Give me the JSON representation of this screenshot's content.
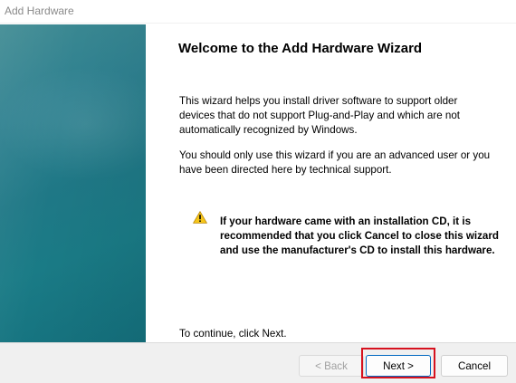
{
  "window": {
    "title": "Add Hardware"
  },
  "wizard": {
    "heading": "Welcome to the Add Hardware Wizard",
    "paragraph1": "This wizard helps you install driver software to support older devices that do not support Plug-and-Play and which are not automatically recognized by Windows.",
    "paragraph2": "You should only use this wizard if you are an advanced user or you have been directed here by technical support.",
    "warning_text": "If your hardware came with an installation CD, it is recommended that you click Cancel to close this wizard and use the manufacturer's CD to install this hardware.",
    "continue_text": "To continue, click Next."
  },
  "buttons": {
    "back_label": "< Back",
    "next_label": "Next >",
    "cancel_label": "Cancel"
  },
  "icons": {
    "warning": "warning-icon"
  },
  "colors": {
    "highlight": "#d6111e",
    "side_panel": "#1f7886",
    "warning_yellow": "#f5c518"
  }
}
